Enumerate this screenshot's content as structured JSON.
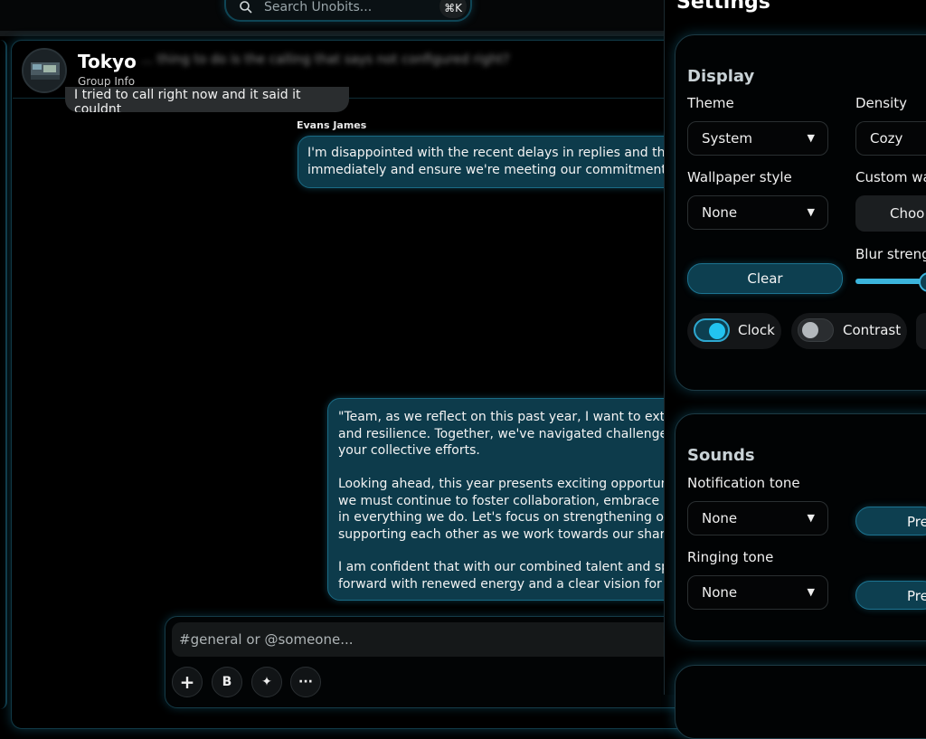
{
  "search": {
    "placeholder": "Search Unobits...",
    "shortcut": "⌘K"
  },
  "chat": {
    "group_name": "Tokyo",
    "group_subtitle": "Group Info",
    "blurred_preview": "... thing to do is the calling that says not configured right?",
    "partial_message": "I tried to call right now and it said it couldnt",
    "sender_name": "Evans James",
    "message1_lines": [
      "I'm disappointed with the recent delays in replies and the c",
      "immediately and ensure we're meeting our commitments."
    ],
    "message2_para1": [
      "\"Team, as we reflect on this past year, I want to extend",
      "and resilience. Together, we've navigated challenges ar",
      "your collective efforts."
    ],
    "message2_para2": [
      "Looking ahead, this year presents exciting opportuniti",
      "we must continue to foster collaboration, embrace ne",
      "in everything we do. Let's focus on strengthening our",
      "supporting each other as we work towards our shared"
    ],
    "message2_para3": [
      "I am confident that with our combined talent and spir",
      "forward with renewed energy and a clear vision for su"
    ],
    "composer_placeholder": "#general or @someone...",
    "tools": {
      "add": "+",
      "bold": "B",
      "ai": "✦",
      "more": "···"
    }
  },
  "settings": {
    "title": "Settings",
    "display": {
      "section_title": "Display",
      "theme_label": "Theme",
      "theme_value": "System",
      "density_label": "Density",
      "density_value": "Cozy",
      "wallpaper_label": "Wallpaper style",
      "wallpaper_value": "None",
      "custom_wallpaper_label": "Custom wa",
      "choose_button": "Choo",
      "clear_button": "Clear",
      "blur_label": "Blur streng",
      "blur_level": 1.0,
      "clock_label": "Clock",
      "clock_on": true,
      "contrast_label": "Contrast",
      "contrast_on": false
    },
    "sounds": {
      "section_title": "Sounds",
      "notification_label": "Notification tone",
      "notification_value": "None",
      "preview_button": "Pre",
      "ringing_label": "Ringing tone",
      "ringing_value": "None",
      "preview_button2": "Pre"
    }
  },
  "colors": {
    "accent": "#22c3f0",
    "bubble": "#0d3b4b",
    "glow": "#1a6b85"
  }
}
